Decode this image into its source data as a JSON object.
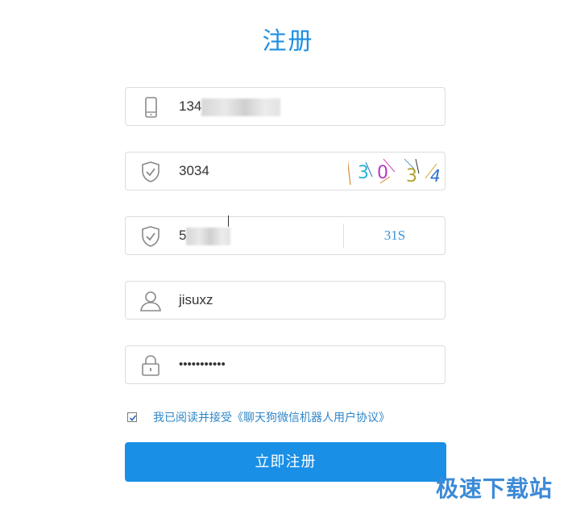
{
  "page": {
    "title": "注册"
  },
  "form": {
    "phone": {
      "value": "134",
      "icon": "phone-icon"
    },
    "captcha": {
      "value": "3034",
      "icon": "shield-check-icon",
      "image_chars": [
        "3",
        "0",
        "3",
        "4"
      ],
      "image_colors": [
        "#2bb3d6",
        "#b43bc4",
        "#b3a233",
        "#2b6fd1"
      ]
    },
    "sms_code": {
      "value": "5",
      "icon": "shield-check-icon",
      "countdown": "31S"
    },
    "username": {
      "value": "jisuxz",
      "icon": "user-icon"
    },
    "password": {
      "value": "•••••••••••",
      "icon": "lock-icon"
    }
  },
  "agreement": {
    "checked": true,
    "text": "我已阅读并接受《聊天狗微信机器人用户协议》"
  },
  "submit": {
    "label": "立即注册"
  },
  "watermark": {
    "text": "极速下载站"
  },
  "colors": {
    "accent": "#1a8fe6",
    "link": "#2e86c8",
    "border": "#dcdcdc"
  }
}
